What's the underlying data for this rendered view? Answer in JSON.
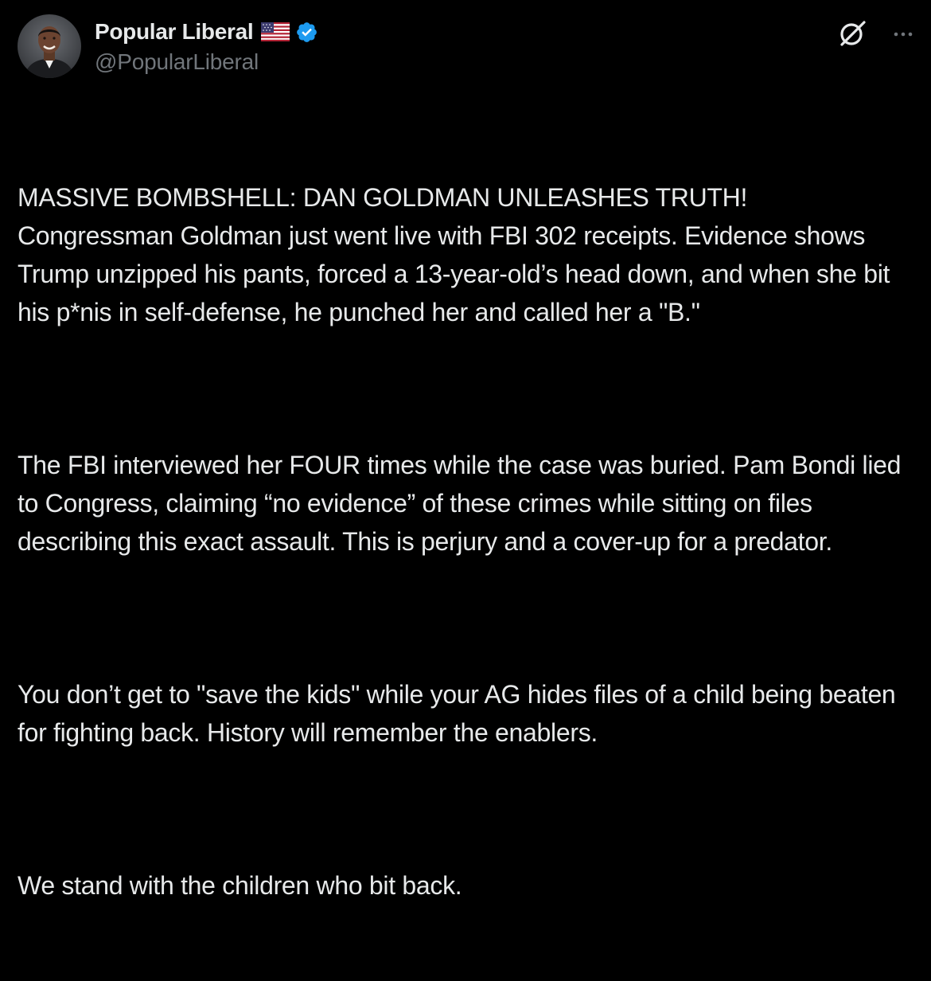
{
  "post": {
    "author": {
      "display_name": "Popular Liberal",
      "handle": "@PopularLiberal",
      "flag_icon": "us-flag-icon",
      "verified_icon": "verified-badge-icon",
      "verified_color": "#1d9bf0"
    },
    "actions": {
      "grok_icon": "grok-icon",
      "more_icon": "more-options-icon"
    },
    "paragraphs": [
      "MASSIVE BOMBSHELL: DAN GOLDMAN UNLEASHES TRUTH!\nCongressman Goldman just went live with FBI 302 receipts. Evidence shows Trump unzipped his pants, forced a 13-year-old’s head down, and when she bit his p*nis in self-defense, he punched her and called her a \"B.\"",
      "The FBI interviewed her FOUR times while the case was buried. Pam Bondi lied to Congress, claiming “no evidence” of these crimes while sitting on files describing this exact assault. This is perjury and a cover-up for a predator.",
      "You don’t get to \"save the kids\" while your AG hides files of a child being beaten for fighting back. History will remember the enablers.",
      "We stand with the children who bit back."
    ]
  },
  "theme": {
    "background": "#000000",
    "primary_text": "#e7e9ea",
    "secondary_text": "#71767b"
  }
}
